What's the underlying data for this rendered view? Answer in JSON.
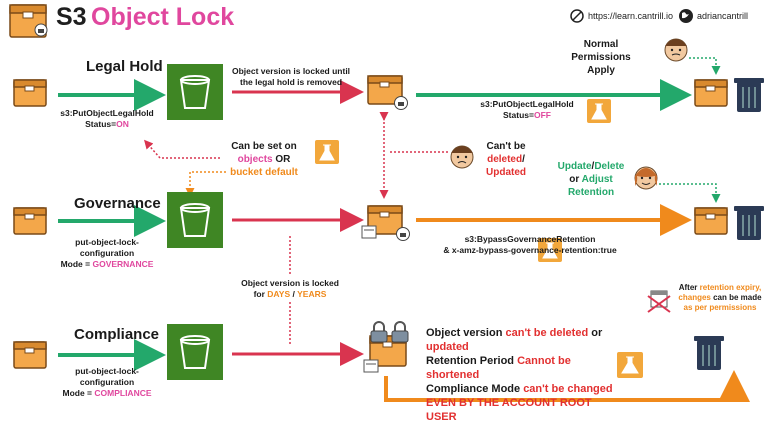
{
  "header": {
    "title_prefix": "S3",
    "title_main": "Object Lock",
    "site": "https://learn.cantrill.io",
    "handle": "adriancantrill"
  },
  "legal_hold": {
    "heading": "Legal Hold",
    "api_line1": "s3:PutObjectLegalHold",
    "status_prefix": "Status=",
    "status_on": "ON",
    "locked_note": "Object version is locked until the legal hold is removed",
    "release_api": "s3:PutObjectLegalHold",
    "release_status_prefix": "Status=",
    "release_status": "OFF",
    "normal_line1": "Normal",
    "normal_line2": "Permissions",
    "normal_line3": "Apply"
  },
  "set_on": {
    "line1": "Can be set on",
    "objects": "objects",
    "or": "OR",
    "bucket_default": "bucket default"
  },
  "cant_delete": {
    "line1": "Can't be",
    "deleted": "deleted",
    "slash": "/",
    "updated": "Updated"
  },
  "governance": {
    "heading": "Governance",
    "cfg_line1": "put-object-lock-",
    "cfg_line2": "configuration",
    "mode_prefix": "Mode = ",
    "mode": "GOVERNANCE",
    "bypass_line1": "s3:BypassGovernanceRetention",
    "bypass_line2": "& x-amz-bypass-governance-retention:true",
    "update": "Update",
    "slash": "/",
    "delete": "Delete",
    "or": "or",
    "adjust": "Adjust",
    "retention": "Retention"
  },
  "locked_for": {
    "line1": "Object version is locked",
    "for": "for",
    "days": "DAYS",
    "slash": "/",
    "years": "YEARS"
  },
  "compliance": {
    "heading": "Compliance",
    "cfg_line1": "put-object-lock-",
    "cfg_line2": "configuration",
    "mode_prefix": "Mode = ",
    "mode": "COMPLIANCE",
    "l1_a": "Object version",
    "l1_b": "can't be deleted",
    "l1_c": "or",
    "l1_d": "updated",
    "l2_a": "Retention Period",
    "l2_b": "Cannot be shortened",
    "l3_a": "Compliance Mode",
    "l3_b": "can't be changed",
    "l4": "EVEN BY THE ACCOUNT ROOT USER",
    "after_a": "After",
    "after_b": "retention expiry,",
    "after_c": "changes",
    "after_d": "can be made",
    "after_e": "as per permissions"
  },
  "colors": {
    "green": "#23a86b",
    "red": "#d9344f",
    "orange": "#f08a1c",
    "pink": "#e0479e",
    "bucket": "#3f8624",
    "lab": "#f2a73b"
  }
}
